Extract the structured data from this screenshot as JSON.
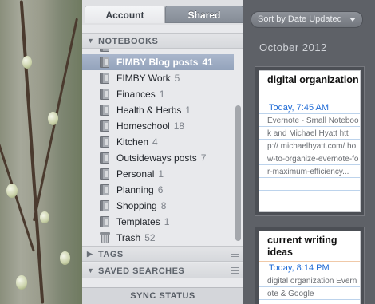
{
  "sidebar": {
    "tabs": [
      {
        "label": "Account"
      },
      {
        "label": "Shared"
      }
    ],
    "notebooks_header": "NOTEBOOKS",
    "notebooks": [
      {
        "name": "FIMBY Blog posts",
        "count": "41"
      },
      {
        "name": "FIMBY Work",
        "count": "5"
      },
      {
        "name": "Finances",
        "count": "1"
      },
      {
        "name": "Health & Herbs",
        "count": "1"
      },
      {
        "name": "Homeschool",
        "count": "18"
      },
      {
        "name": "Kitchen",
        "count": "4"
      },
      {
        "name": "Outsideways posts",
        "count": "7"
      },
      {
        "name": "Personal",
        "count": "1"
      },
      {
        "name": "Planning",
        "count": "6"
      },
      {
        "name": "Shopping",
        "count": "8"
      },
      {
        "name": "Templates",
        "count": "1"
      },
      {
        "name": "Trash",
        "count": "52",
        "icon": "trash-icon"
      }
    ],
    "tags_header": "TAGS",
    "saved_searches_header": "SAVED SEARCHES",
    "sync_status": "SYNC STATUS"
  },
  "notes": {
    "sort_label": "Sort by Date Updated",
    "month_heading": "October 2012",
    "cards": [
      {
        "title": "digital organization",
        "date": "Today, 7:45 AM",
        "snippet": "Evernote - Small Notebook and Michael Hyatt http:// michaelhyatt.com/ how-to-organize-evernote-for-maximum-efficiency..."
      },
      {
        "title": "current writing ideas",
        "date": "Today, 8:14 PM",
        "snippet": "digital organization Evernote & Google"
      }
    ]
  },
  "colors": {
    "accent_blue": "#1f6bd6",
    "selection": "#93a3bb",
    "note_list_bg": "#5e6167"
  }
}
